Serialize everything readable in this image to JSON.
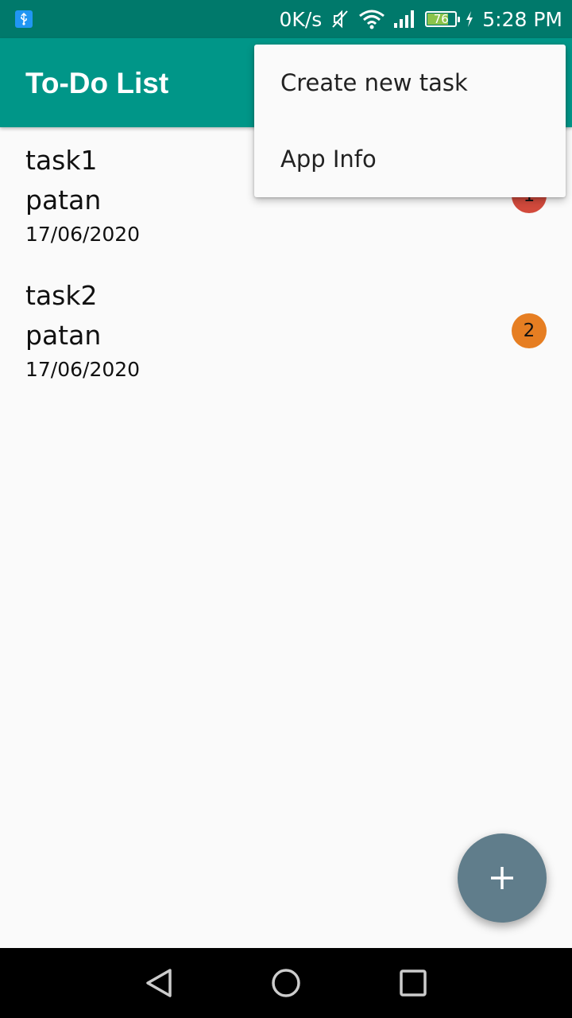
{
  "status_bar": {
    "net_speed": "0K/s",
    "battery_level": "76",
    "time": "5:28 PM",
    "icons": [
      "usb-icon",
      "mute-icon",
      "wifi-icon",
      "signal-icon",
      "battery-icon",
      "charging-icon"
    ]
  },
  "app_bar": {
    "title": "To-Do List"
  },
  "tasks": [
    {
      "name": "task1",
      "assignee": "patan",
      "date": "17/06/2020",
      "priority": "1",
      "badge_color": "#d24a3c"
    },
    {
      "name": "task2",
      "assignee": "patan",
      "date": "17/06/2020",
      "priority": "2",
      "badge_color": "#e67e22"
    }
  ],
  "overflow_menu": {
    "items": [
      {
        "label": "Create new task"
      },
      {
        "label": "App Info"
      }
    ]
  },
  "fab": {
    "icon": "plus-icon",
    "color": "#607d8b"
  },
  "nav_bar": {
    "buttons": [
      "back-icon",
      "home-icon",
      "recents-icon"
    ]
  },
  "colors": {
    "app_bar": "#009688",
    "status_bar": "#00796b",
    "background": "#fafafa"
  }
}
